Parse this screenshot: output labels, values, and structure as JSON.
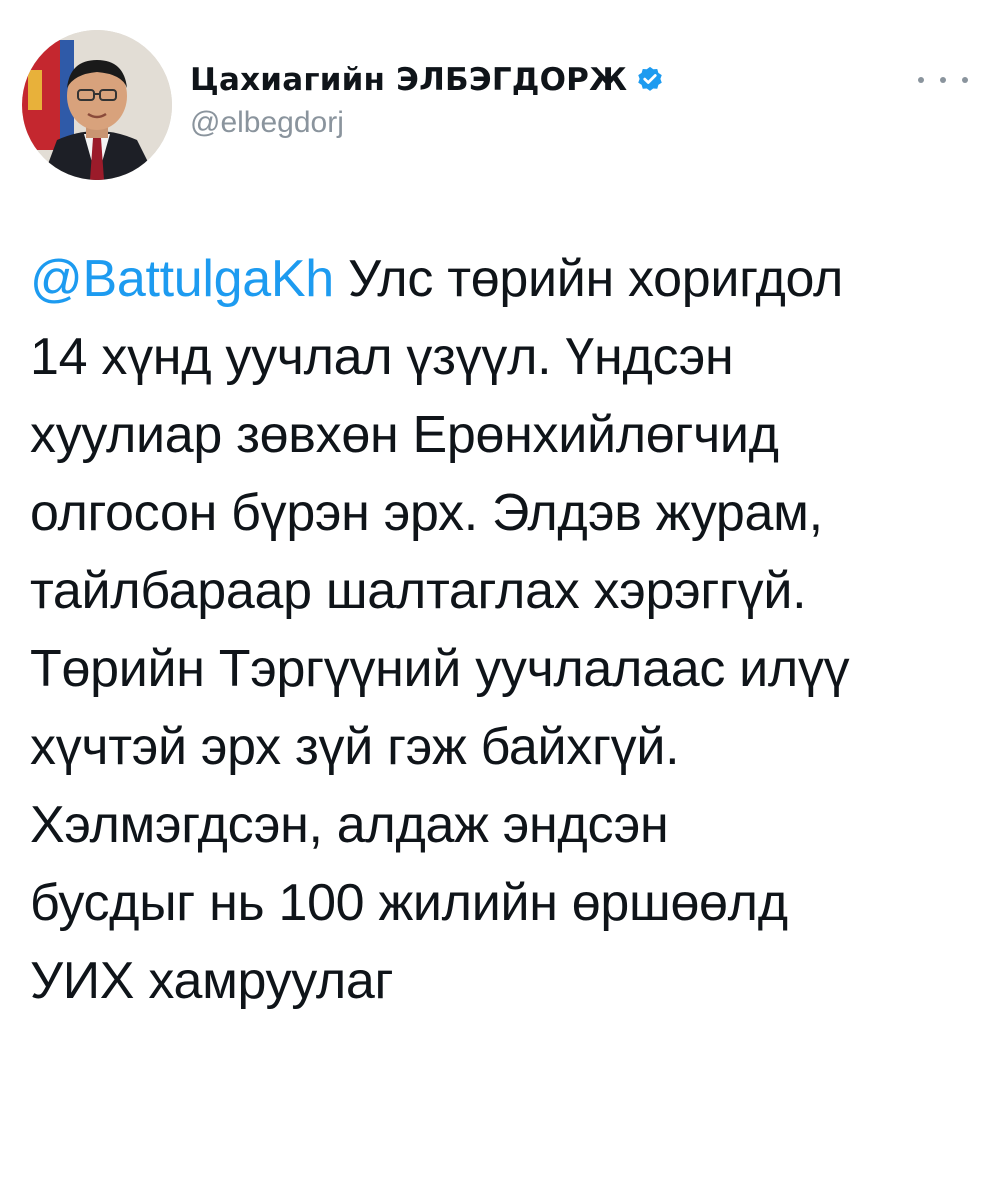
{
  "author": {
    "display_name": "Цахиагийн ЭЛБЭГДОРЖ",
    "handle": "@elbegdorj",
    "verified": true,
    "avatar": "avatar-photo"
  },
  "menu": {
    "icon": "more-options-icon"
  },
  "tweet": {
    "mention": "@BattulgaKh",
    "first_line_rest": " Улс төрийн хоригдол",
    "lines": [
      "14 хүнд уучлал үзүүл. Үндсэн",
      "хуулиар зөвхөн Ерөнхийлөгчид",
      "олгосон бүрэн эрх. Элдэв журам,",
      "тайлбараар шалтаглах хэрэггүй.",
      "Төрийн Тэргүүний уучлалаас илүү",
      "хүчтэй эрх зүй гэж байхгүй.",
      "Хэлмэгдсэн, алдаж эндсэн",
      "бусдыг нь 100 жилийн өршөөлд",
      "УИХ хамруулаг"
    ]
  },
  "colors": {
    "mention": "#1d9bf0",
    "verified_badge": "#1d9bf0",
    "handle": "#8a949d",
    "text": "#0f1419"
  }
}
